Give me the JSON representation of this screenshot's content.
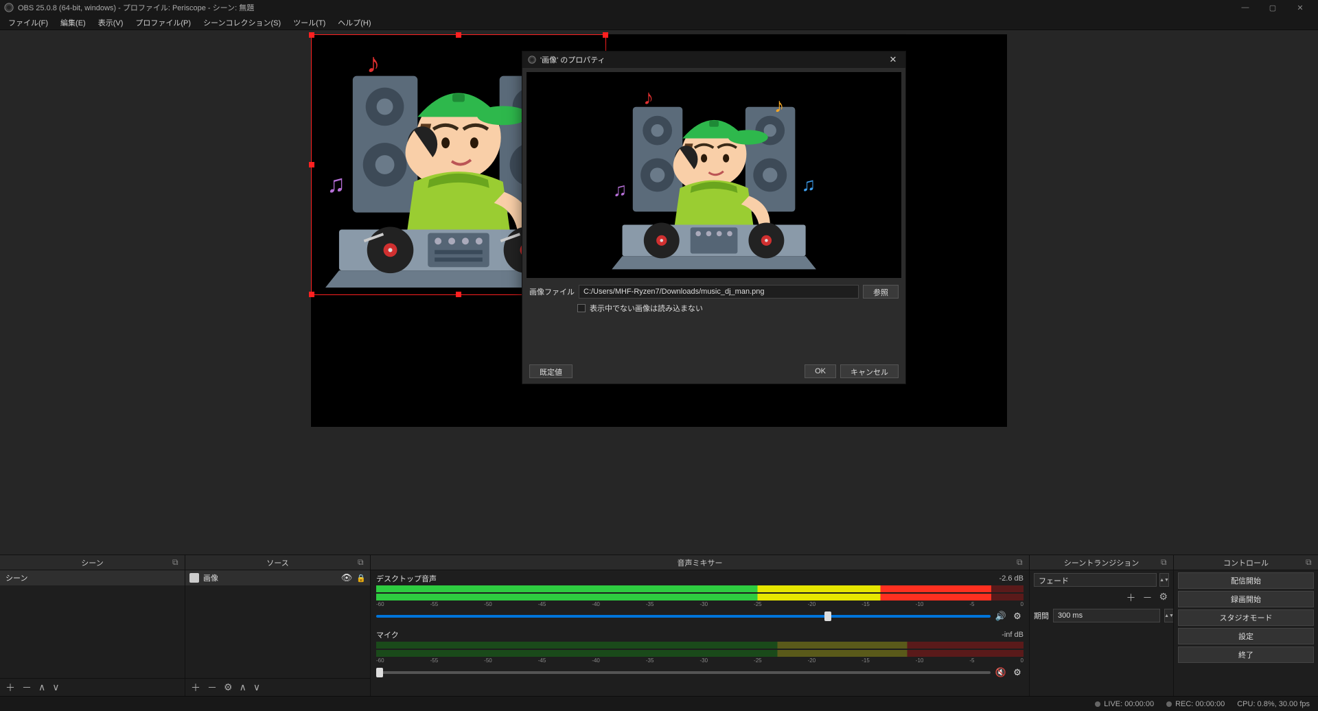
{
  "titlebar": {
    "title": "OBS 25.0.8 (64-bit, windows) - プロファイル: Periscope - シーン: 無題"
  },
  "menubar": {
    "items": [
      "ファイル(F)",
      "編集(E)",
      "表示(V)",
      "プロファイル(P)",
      "シーンコレクション(S)",
      "ツール(T)",
      "ヘルプ(H)"
    ]
  },
  "dialog": {
    "title": "'画像' のプロパティ",
    "file_label": "画像ファイル",
    "file_path": "C:/Users/MHF-Ryzen7/Downloads/music_dj_man.png",
    "browse": "参照",
    "checkbox_label": "表示中でない画像は読み込まない",
    "defaults": "既定値",
    "ok": "OK",
    "cancel": "キャンセル"
  },
  "docks": {
    "scenes": {
      "title": "シーン",
      "items": [
        "シーン"
      ]
    },
    "sources": {
      "title": "ソース",
      "items": [
        {
          "label": "画像"
        }
      ]
    },
    "mixer": {
      "title": "音声ミキサー",
      "tracks": [
        {
          "name": "デスクトップ音声",
          "db": "-2.6 dB",
          "fill_pct": 95,
          "thumb_pct": 73,
          "muted": false,
          "slider_color": "blue"
        },
        {
          "name": "マイク",
          "db": "-inf dB",
          "fill_pct": 0,
          "thumb_pct": 0,
          "muted": true,
          "slider_color": "gray"
        }
      ],
      "scale": [
        "-60",
        "-55",
        "-50",
        "-45",
        "-40",
        "-35",
        "-30",
        "-25",
        "-20",
        "-15",
        "-10",
        "-5",
        "0"
      ]
    },
    "transitions": {
      "title": "シーントランジション",
      "selected": "フェード",
      "duration_label": "期間",
      "duration_value": "300 ms"
    },
    "controls": {
      "title": "コントロール",
      "buttons": [
        "配信開始",
        "録画開始",
        "スタジオモード",
        "設定",
        "終了"
      ]
    }
  },
  "statusbar": {
    "live": "LIVE: 00:00:00",
    "rec": "REC: 00:00:00",
    "cpu": "CPU: 0.8%, 30.00 fps"
  }
}
